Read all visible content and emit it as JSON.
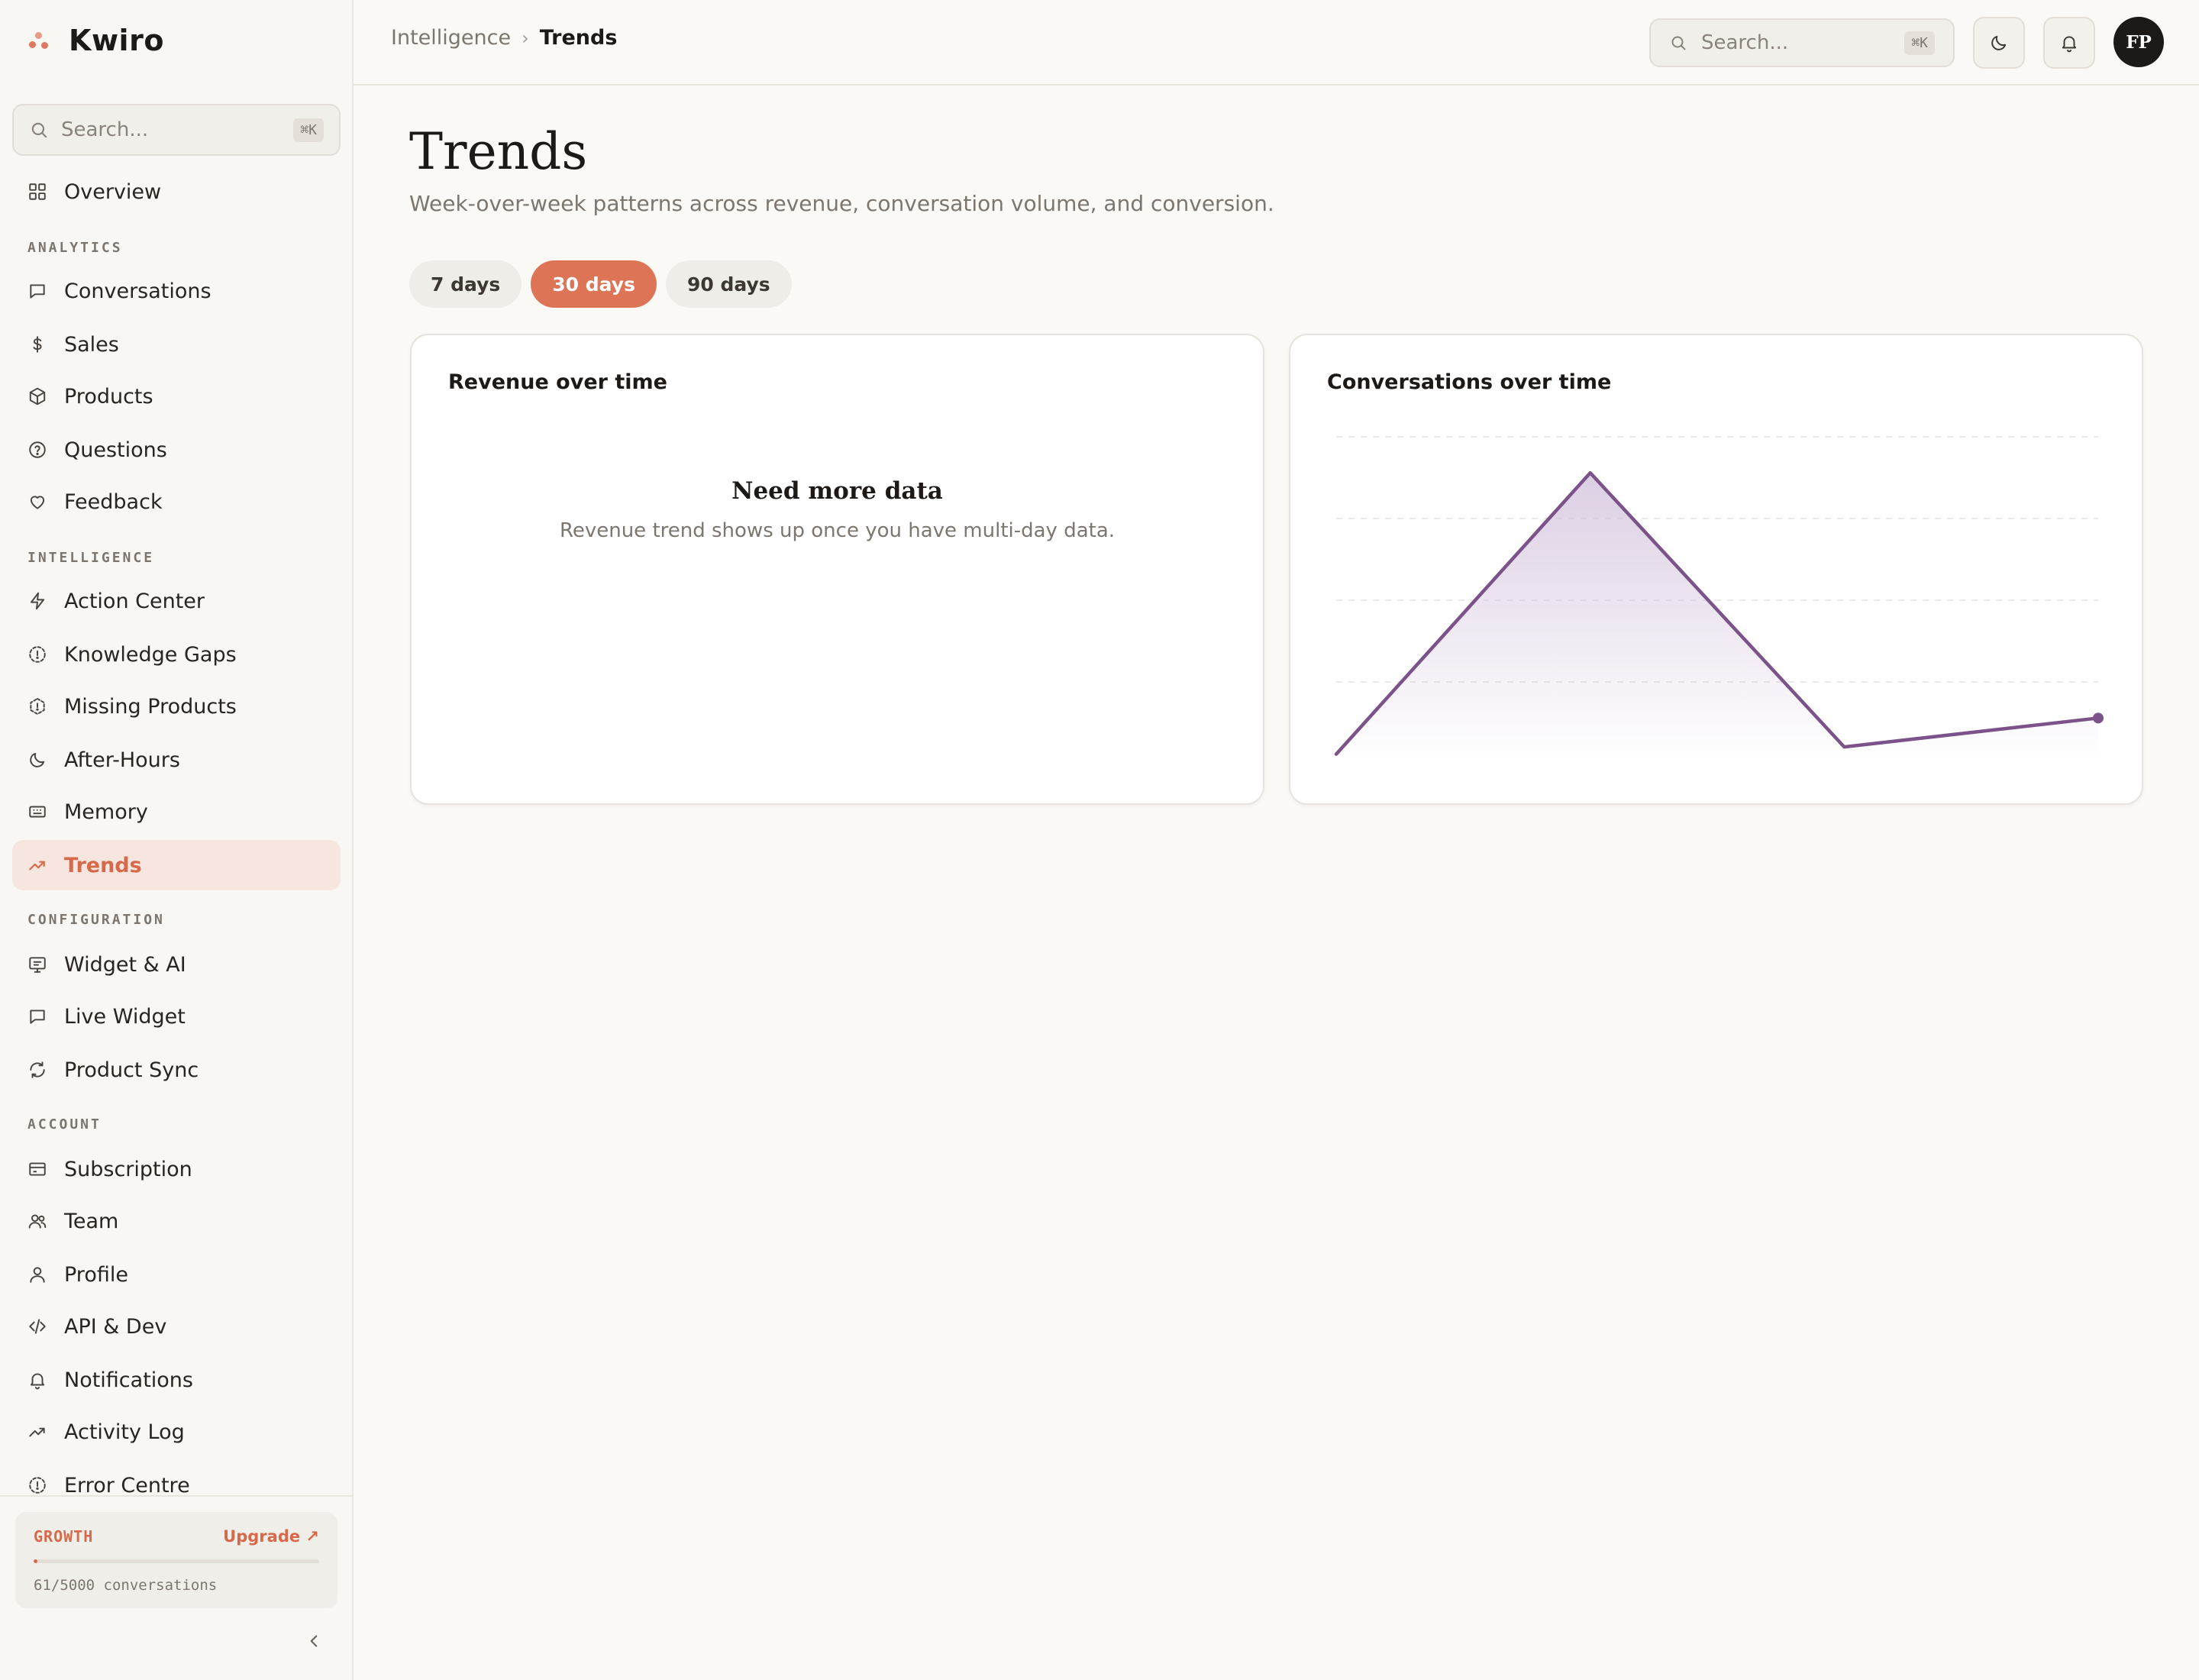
{
  "brand": {
    "name": "Kwiro"
  },
  "sidebar": {
    "search": {
      "placeholder": "Search...",
      "shortcut": "⌘K"
    },
    "overview": {
      "label": "Overview",
      "icon": "grid-icon"
    },
    "sections": {
      "analytics": {
        "title": "ANALYTICS",
        "items": [
          {
            "label": "Conversations",
            "icon": "message-icon"
          },
          {
            "label": "Sales",
            "icon": "dollar-icon"
          },
          {
            "label": "Products",
            "icon": "box-icon"
          },
          {
            "label": "Questions",
            "icon": "help-circle-icon"
          },
          {
            "label": "Feedback",
            "icon": "heart-icon"
          }
        ]
      },
      "intelligence": {
        "title": "INTELLIGENCE",
        "items": [
          {
            "label": "Action Center",
            "icon": "lightning-icon"
          },
          {
            "label": "Knowledge Gaps",
            "icon": "dashed-circle-icon"
          },
          {
            "label": "Missing Products",
            "icon": "dashed-hexagon-icon"
          },
          {
            "label": "After-Hours",
            "icon": "moon-icon"
          },
          {
            "label": "Memory",
            "icon": "memory-icon"
          },
          {
            "label": "Trends",
            "icon": "trending-up-icon",
            "active": true
          }
        ]
      },
      "configuration": {
        "title": "CONFIGURATION",
        "items": [
          {
            "label": "Widget & AI",
            "icon": "monitor-icon"
          },
          {
            "label": "Live Widget",
            "icon": "message-icon"
          },
          {
            "label": "Product Sync",
            "icon": "refresh-icon"
          }
        ]
      },
      "account": {
        "title": "ACCOUNT",
        "items": [
          {
            "label": "Subscription",
            "icon": "credit-card-icon"
          },
          {
            "label": "Team",
            "icon": "users-icon"
          },
          {
            "label": "Profile",
            "icon": "user-icon"
          },
          {
            "label": "API & Dev",
            "icon": "code-icon"
          },
          {
            "label": "Notifications",
            "icon": "bell-icon"
          },
          {
            "label": "Activity Log",
            "icon": "activity-icon"
          },
          {
            "label": "Error Centre",
            "icon": "alert-circle-icon"
          }
        ]
      }
    },
    "plan": {
      "name": "GROWTH",
      "upgrade_label": "Upgrade ↗",
      "usage_text": "61/5000 conversations",
      "used": 61,
      "limit": 5000
    }
  },
  "topbar": {
    "breadcrumb": {
      "parent": "Intelligence",
      "separator": "›",
      "current": "Trends"
    },
    "search": {
      "placeholder": "Search...",
      "shortcut": "⌘K"
    },
    "avatar_initials": "FP"
  },
  "main": {
    "title": "Trends",
    "subtitle": "Week-over-week patterns across revenue, conversation volume, and conversion.",
    "ranges": [
      {
        "label": "7 days",
        "active": false
      },
      {
        "label": "30 days",
        "active": true
      },
      {
        "label": "90 days",
        "active": false
      }
    ],
    "revenue_card": {
      "title": "Revenue over time",
      "empty_title": "Need more data",
      "empty_subtitle": "Revenue trend shows up once you have multi-day data."
    },
    "conversations_card": {
      "title": "Conversations over time"
    }
  },
  "colors": {
    "accent": "#dc7455",
    "chart_line": "#7b5289",
    "chart_fill": "#e4d8ea"
  },
  "chart_data": {
    "type": "area",
    "title": "Conversations over time",
    "x": [
      0,
      1,
      2,
      3
    ],
    "values": [
      1,
      40,
      2,
      6
    ],
    "ylim": [
      0,
      45
    ],
    "grid": true,
    "xlabel": "",
    "ylabel": ""
  }
}
